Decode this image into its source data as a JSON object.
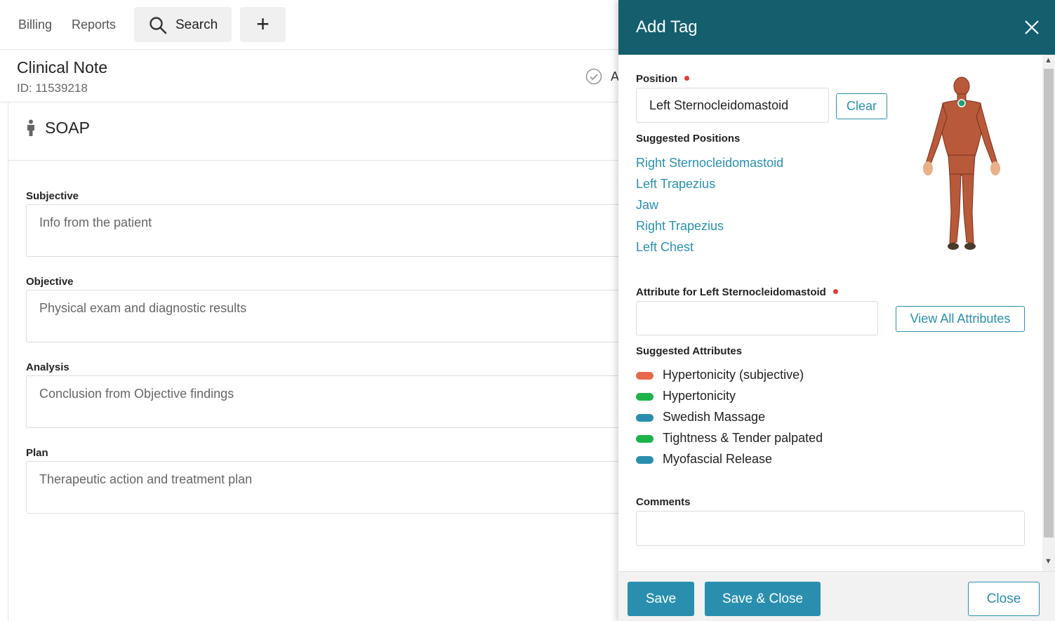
{
  "nav": {
    "billing": "Billing",
    "reports": "Reports",
    "search": "Search",
    "add": "+"
  },
  "note": {
    "title": "Clinical Note",
    "id": "ID: 11539218",
    "truncated_label": "A",
    "section_title": "SOAP"
  },
  "fields": [
    {
      "label": "Subjective",
      "placeholder": "Info from the patient"
    },
    {
      "label": "Objective",
      "placeholder": "Physical exam and diagnostic results"
    },
    {
      "label": "Analysis",
      "placeholder": "Conclusion from Objective findings"
    },
    {
      "label": "Plan",
      "placeholder": "Therapeutic action and treatment plan"
    }
  ],
  "modal": {
    "title": "Add Tag",
    "position_label": "Position",
    "position_value": "Left Sternocleidomastoid",
    "clear_label": "Clear",
    "suggested_positions_label": "Suggested Positions",
    "suggested_positions": [
      "Right Sternocleidomastoid",
      "Left Trapezius",
      "Jaw",
      "Right Trapezius",
      "Left Chest"
    ],
    "attribute_label": "Attribute for Left Sternocleidomastoid",
    "attribute_value": "",
    "view_all_label": "View All Attributes",
    "suggested_attributes_label": "Suggested Attributes",
    "suggested_attributes": [
      {
        "label": "Hypertonicity (subjective)",
        "color": "#e8674a"
      },
      {
        "label": "Hypertonicity",
        "color": "#1db34a"
      },
      {
        "label": "Swedish Massage",
        "color": "#2a8fae"
      },
      {
        "label": "Tightness & Tender palpated",
        "color": "#1db34a"
      },
      {
        "label": "Myofascial Release",
        "color": "#2a8fae"
      }
    ],
    "comments_label": "Comments",
    "comments_value": "",
    "save_label": "Save",
    "save_close_label": "Save & Close",
    "close_label": "Close"
  },
  "colors": {
    "header_bg": "#145e6e",
    "accent": "#2a8fae",
    "required": "#e53935"
  }
}
